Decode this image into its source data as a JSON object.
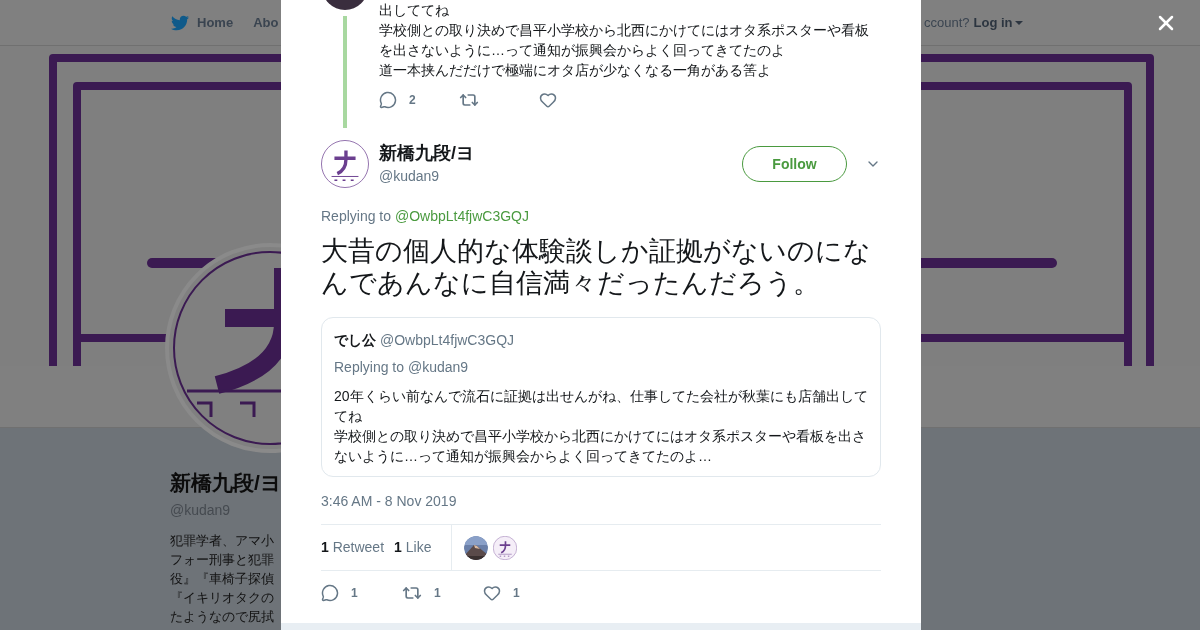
{
  "background_page": {
    "nav": {
      "items": [
        {
          "label": "Home"
        },
        {
          "label": "Abo"
        }
      ],
      "account_prompt": "ccount?",
      "login": "Log in"
    },
    "profile": {
      "name": "新橋九段/ヨ",
      "handle": "@kudan9",
      "bio_lines": [
        "犯罪学者、アマ小",
        "フォー刑事と犯罪",
        "役』『車椅子探偵",
        "『イキリオタクの",
        "たようなので尻拭"
      ]
    }
  },
  "previous_tweet": {
    "paragraphs": [
      "出しててね",
      "学校側との取り決めで昌平小学校から北西にかけてにはオタ系ポスターや看板を出さないように…って通知が振興会からよく回ってきてたのよ",
      "道一本挟んだだけで極端にオタ店が少なくなる一角がある筈よ"
    ],
    "reply_count": "2"
  },
  "tweet": {
    "name": "新橋九段/ヨ",
    "handle": "@kudan9",
    "follow": "Follow",
    "replying_label": "Replying to",
    "replying_to": "@OwbpLt4fjwC3GQJ",
    "text": "大昔の個人的な体験談しか証拠がないのになんであんなに自信満々だったんだろう。",
    "quote": {
      "name": "でし公",
      "handle": "@OwbpLt4fjwC3GQJ",
      "replying": "Replying to @kudan9",
      "paragraphs": [
        "20年くらい前なんで流石に証拠は出せんがね、仕事してた会社が秋葉にも店舗出しててね",
        "学校側との取り決めで昌平小学校から北西にかけてにはオタ系ポスターや看板を出さないように…って通知が振興会からよく回ってきてたのよ…"
      ]
    },
    "timestamp": "3:46 AM - 8 Nov 2019",
    "stats": [
      {
        "count": "1",
        "label": "Retweet"
      },
      {
        "count": "1",
        "label": "Like"
      }
    ],
    "likers": [
      {
        "kind": "mountain"
      },
      {
        "kind": "logo"
      }
    ],
    "actions": [
      {
        "kind": "reply",
        "count": "1"
      },
      {
        "kind": "retweet",
        "count": "1"
      },
      {
        "kind": "like",
        "count": "1"
      }
    ]
  }
}
